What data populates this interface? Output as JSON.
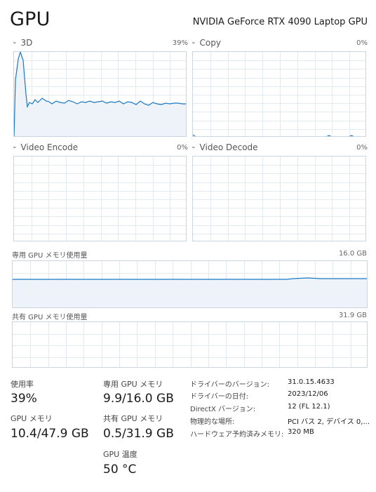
{
  "header": {
    "title": "GPU",
    "gpu_name": "NVIDIA GeForce RTX 4090 Laptop GPU"
  },
  "engines": [
    {
      "label": "3D",
      "percent": "39%",
      "utilization": 0.39
    },
    {
      "label": "Copy",
      "percent": "0%",
      "utilization": 0.0
    },
    {
      "label": "Video Encode",
      "percent": "0%",
      "utilization": 0.0
    },
    {
      "label": "Video Decode",
      "percent": "0%",
      "utilization": 0.0
    }
  ],
  "dedicated_memory_graph": {
    "label": "専用 GPU メモリ使用量",
    "max": "16.0 GB"
  },
  "shared_memory_graph": {
    "label": "共有 GPU メモリ使用量",
    "max": "31.9 GB"
  },
  "stats": {
    "utilization": {
      "label": "使用率",
      "value": "39%"
    },
    "gpu_memory": {
      "label": "GPU メモリ",
      "value": "10.4/47.9 GB"
    },
    "dedicated_memory": {
      "label": "専用 GPU メモリ",
      "value": "9.9/16.0 GB"
    },
    "shared_memory": {
      "label": "共有 GPU メモリ",
      "value": "0.5/31.9 GB"
    },
    "temperature": {
      "label": "GPU 温度",
      "value": "50 °C"
    }
  },
  "info": [
    {
      "key": "ドライバーのバージョン:",
      "value": "31.0.15.4633"
    },
    {
      "key": "ドライバーの日付:",
      "value": "2023/12/06"
    },
    {
      "key": "DirectX バージョン:",
      "value": "12 (FL 12.1)"
    },
    {
      "key": "物理的な場所:",
      "value": "PCI バス 2, デバイス 0,..."
    },
    {
      "key": "ハードウェア予約済みメモリ:",
      "value": "320 MB"
    }
  ],
  "colors": {
    "line": "#1a78c2",
    "fill": "#eef3fa",
    "grid": "#e3e9f1",
    "border": "#c8d5e3"
  }
}
